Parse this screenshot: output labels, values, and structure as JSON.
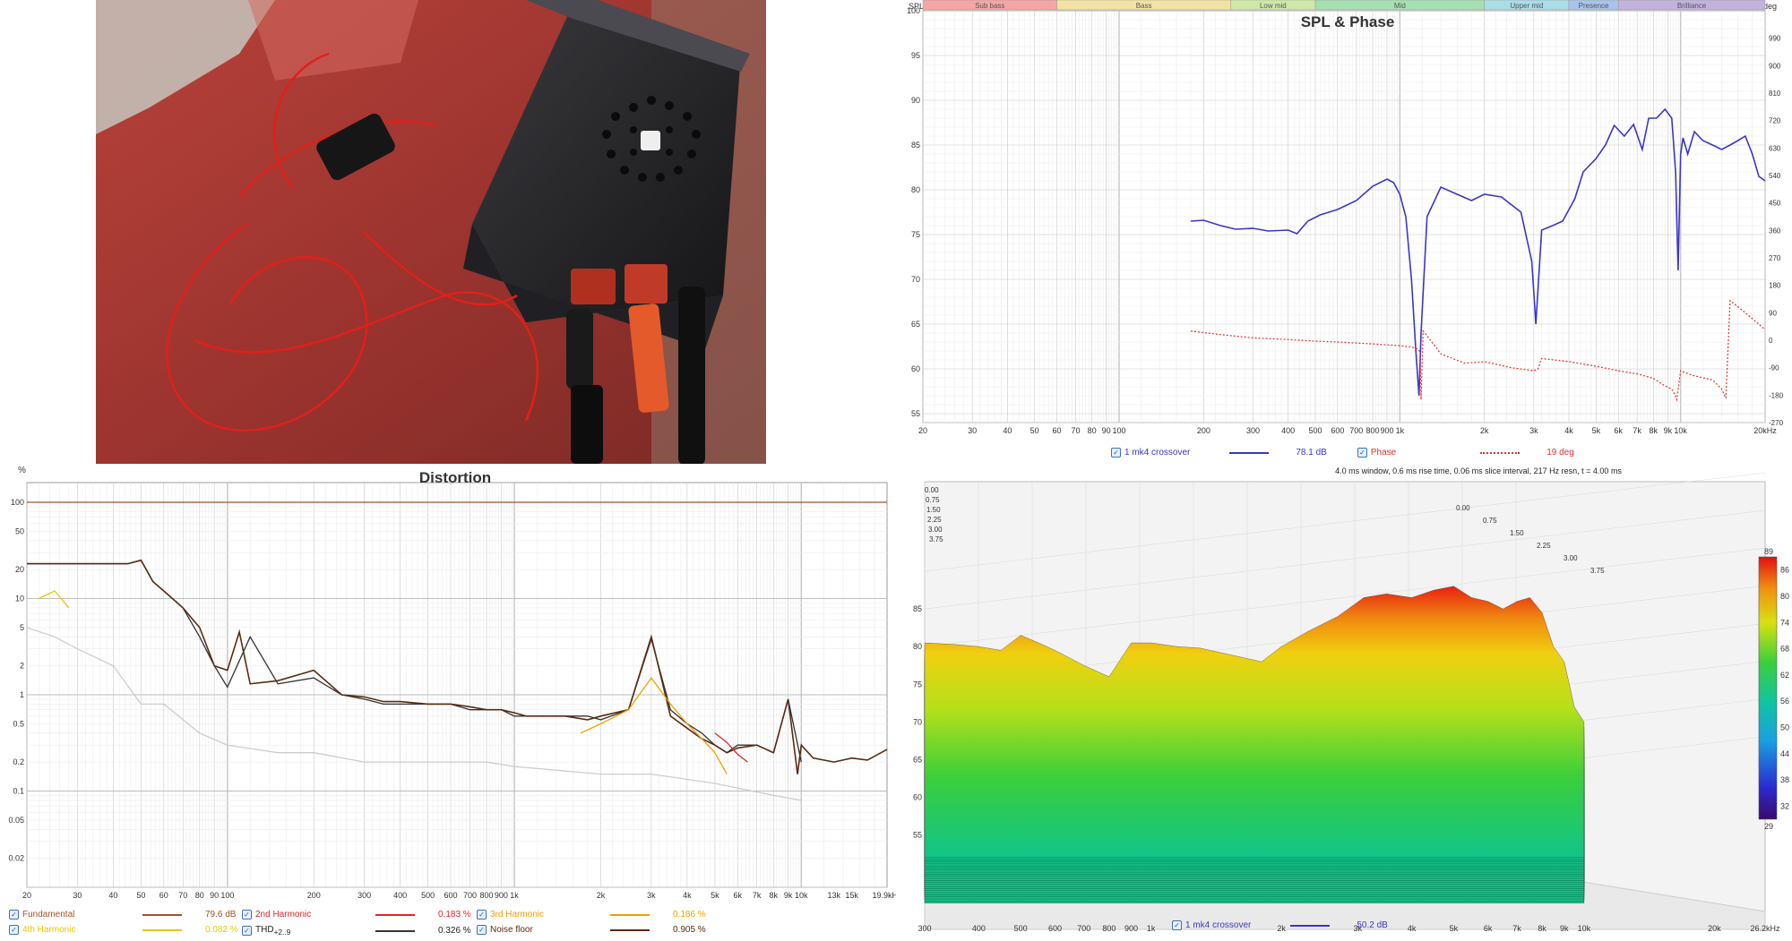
{
  "spl_phase": {
    "chart_data": {
      "type": "line",
      "title": "SPL & Phase",
      "ylabel_left": "SPL",
      "ylabel_right": "deg",
      "x_scale": "log",
      "xlim": [
        20,
        20000
      ],
      "ylim": [
        54,
        100
      ],
      "y2lim": [
        -270,
        1080
      ],
      "x_ticks": [
        "20",
        "30",
        "40",
        "50",
        "60",
        "70",
        "80",
        "90",
        "100",
        "200",
        "300",
        "400",
        "500",
        "600",
        "700",
        "800",
        "900",
        "1k",
        "2k",
        "3k",
        "4k",
        "5k",
        "6k",
        "7k",
        "8k",
        "9k",
        "10k",
        "20kHz"
      ],
      "y_ticks": [
        55,
        60,
        65,
        70,
        75,
        80,
        85,
        90,
        95,
        100
      ],
      "y2_ticks": [
        -270,
        -180,
        -90,
        0,
        90,
        180,
        270,
        360,
        450,
        540,
        630,
        720,
        810,
        900,
        990
      ],
      "bands": [
        {
          "name": "Sub bass",
          "from": 20,
          "to": 60,
          "color": "#f6a5a5"
        },
        {
          "name": "Bass",
          "from": 60,
          "to": 250,
          "color": "#f3e3a2"
        },
        {
          "name": "Low mid",
          "from": 250,
          "to": 500,
          "color": "#cfe8a8"
        },
        {
          "name": "Mid",
          "from": 500,
          "to": 2000,
          "color": "#a6e0b0"
        },
        {
          "name": "Upper mid",
          "from": 2000,
          "to": 4000,
          "color": "#a9dde8"
        },
        {
          "name": "Presence",
          "from": 4000,
          "to": 6000,
          "color": "#a8c4ec"
        },
        {
          "name": "Brilliance",
          "from": 6000,
          "to": 20000,
          "color": "#c2b2de"
        }
      ],
      "series": [
        {
          "name": "1 mk4 crossover",
          "value_label": "78.1 dB",
          "color": "#3b35c8",
          "x": [
            180,
            200,
            230,
            260,
            300,
            340,
            400,
            430,
            470,
            520,
            600,
            700,
            800,
            900,
            950,
            1000,
            1050,
            1100,
            1140,
            1170,
            1190,
            1250,
            1400,
            1600,
            1800,
            2000,
            2300,
            2700,
            2950,
            3050,
            3200,
            3500,
            3800,
            4200,
            4500,
            5000,
            5400,
            5800,
            6300,
            6800,
            7300,
            7700,
            8200,
            8800,
            9300,
            9600,
            9800,
            10000,
            10200,
            10600,
            11200,
            12000,
            13000,
            14000,
            15000,
            16000,
            17000,
            18000,
            19000,
            20000
          ],
          "y": [
            76.5,
            76.6,
            76,
            75.6,
            75.7,
            75.4,
            75.5,
            75.1,
            76.5,
            77.2,
            77.8,
            78.8,
            80.4,
            81.2,
            80.8,
            79.5,
            77,
            70,
            62,
            57,
            64,
            77,
            80.3,
            79.5,
            78.8,
            79.5,
            79.2,
            77.5,
            72,
            65,
            75.5,
            76,
            76.5,
            79,
            82,
            83.5,
            85,
            87.2,
            86,
            87.3,
            84.5,
            88,
            88,
            89,
            88,
            82,
            71,
            84,
            85.8,
            84,
            86.5,
            85.5,
            85,
            84.5,
            85,
            85.5,
            86,
            84,
            81.5,
            81
          ]
        },
        {
          "name": "Phase",
          "value_label": "19 deg",
          "color": "#e0302e",
          "style": "dotted",
          "x": [
            180,
            200,
            250,
            300,
            400,
            500,
            600,
            800,
            1000,
            1100,
            1150,
            1180,
            1190,
            1210,
            1260,
            1400,
            1700,
            2000,
            2500,
            3000,
            3100,
            3200,
            4000,
            5000,
            6000,
            7000,
            8000,
            8800,
            9300,
            9500,
            9700,
            10000,
            11000,
            13000,
            14000,
            14500,
            15000,
            17000,
            20000
          ],
          "y": [
            30,
            25,
            15,
            8,
            2,
            -3,
            -6,
            -12,
            -18,
            -22,
            -28,
            -38,
            -195,
            30,
            10,
            -45,
            -75,
            -70,
            -90,
            -100,
            -95,
            -60,
            -70,
            -85,
            -100,
            -110,
            -125,
            -150,
            -160,
            -175,
            -195,
            -100,
            -115,
            -130,
            -160,
            -190,
            130,
            90,
            35
          ]
        }
      ]
    }
  },
  "distortion": {
    "chart_data": {
      "type": "line",
      "title": "Distortion",
      "ylabel": "%",
      "x_scale": "log",
      "y_scale": "log",
      "xlim": [
        20,
        19900
      ],
      "ylim": [
        0.01,
        100
      ],
      "x_ticks": [
        "20",
        "30",
        "40",
        "50",
        "60",
        "70",
        "80",
        "90",
        "100",
        "1k",
        "200",
        "300",
        "400",
        "500",
        "600",
        "700",
        "800",
        "900",
        "2k",
        "3k",
        "4k",
        "5k",
        "6k",
        "7k",
        "8k",
        "9k",
        "10k",
        "13k",
        "15k",
        "19.9kHz"
      ],
      "y_ticks": [
        "100",
        "50",
        "20",
        "10",
        "5",
        "2",
        "1",
        "0.5",
        "0.2",
        "0.1",
        "0.05",
        "0.02"
      ],
      "series": [
        {
          "name": "Fundamental",
          "value_label": "79.6 dB",
          "color": "#a0522d",
          "x": [
            20,
            19900
          ],
          "y": [
            100,
            100
          ]
        },
        {
          "name": "2nd Harmonic",
          "value_label": "0.183 %",
          "color": "#e3242b",
          "x": [
            5000,
            5500,
            6000,
            6500
          ],
          "y": [
            0.4,
            0.32,
            0.24,
            0.2
          ]
        },
        {
          "name": "3rd Harmonic",
          "value_label": "0.186 %",
          "color": "#f0a000",
          "x": [
            1700,
            2000,
            2500,
            3000,
            3500,
            4000,
            4500,
            5000,
            5500
          ],
          "y": [
            0.4,
            0.5,
            0.7,
            1.5,
            0.8,
            0.5,
            0.35,
            0.25,
            0.15
          ]
        },
        {
          "name": "4th Harmonic",
          "value_label": "0.082 %",
          "color": "#e8c800",
          "x": [
            22,
            25,
            28
          ],
          "y": [
            10,
            12,
            8
          ]
        },
        {
          "name": "THD",
          "value_label": "0.326 %",
          "color": "#333333",
          "x": [
            20,
            25,
            30,
            35,
            40,
            45,
            50,
            55,
            60,
            70,
            80,
            90,
            100,
            120,
            150,
            200,
            250,
            300,
            350,
            400,
            500,
            600,
            700,
            800,
            900,
            1000,
            1200,
            1500,
            1800,
            2000,
            2500,
            3000,
            3500,
            4000,
            4500,
            5000,
            5500,
            6000,
            7000,
            8000,
            9000,
            10000
          ],
          "y": [
            23,
            23,
            23,
            23,
            23,
            23,
            25,
            15,
            12,
            8,
            4,
            2,
            1.2,
            4,
            1.3,
            1.5,
            1.0,
            0.9,
            0.8,
            0.8,
            0.8,
            0.8,
            0.7,
            0.7,
            0.7,
            0.6,
            0.6,
            0.6,
            0.6,
            0.55,
            0.7,
            3.8,
            0.7,
            0.5,
            0.4,
            0.3,
            0.25,
            0.3,
            0.3,
            0.25,
            0.9,
            0.2
          ]
        },
        {
          "name": "Noise floor",
          "value_label": "0.905 %",
          "color": "#5a2a14",
          "x": [
            20,
            25,
            30,
            35,
            40,
            45,
            50,
            55,
            60,
            70,
            80,
            90,
            100,
            110,
            120,
            150,
            200,
            250,
            300,
            350,
            400,
            500,
            600,
            700,
            800,
            900,
            1000,
            1100,
            1200,
            1500,
            1800,
            2000,
            2500,
            3000,
            3500,
            4000,
            4500,
            5000,
            5500,
            6000,
            7000,
            8000,
            9000,
            9700,
            10000,
            11000,
            13000,
            15000,
            17000,
            19900
          ],
          "y": [
            23,
            23,
            23,
            23,
            23,
            23,
            25,
            15,
            12,
            8,
            5,
            2,
            1.8,
            4.5,
            1.3,
            1.4,
            1.8,
            1.0,
            0.95,
            0.85,
            0.85,
            0.8,
            0.8,
            0.75,
            0.7,
            0.7,
            0.65,
            0.6,
            0.6,
            0.6,
            0.55,
            0.6,
            0.7,
            4.0,
            0.6,
            0.45,
            0.35,
            0.3,
            0.25,
            0.28,
            0.3,
            0.25,
            0.9,
            0.15,
            0.3,
            0.22,
            0.2,
            0.22,
            0.21,
            0.27
          ]
        },
        {
          "name": "grey-harmonics",
          "color": "#c8c8c8",
          "x": [
            20,
            25,
            30,
            40,
            50,
            60,
            80,
            100,
            150,
            200,
            300,
            500,
            800,
            1000,
            2000,
            3000,
            5000,
            8000,
            10000
          ],
          "y": [
            5,
            4,
            3,
            2,
            0.8,
            0.8,
            0.4,
            0.3,
            0.25,
            0.25,
            0.2,
            0.2,
            0.2,
            0.18,
            0.15,
            0.15,
            0.12,
            0.09,
            0.08
          ]
        }
      ]
    },
    "legend": [
      {
        "label": "Fundamental",
        "value": "79.6 dB",
        "color": "#a0522d"
      },
      {
        "label": "2nd Harmonic",
        "value": "0.183 %",
        "color": "#e3242b"
      },
      {
        "label": "3rd Harmonic",
        "value": "0.186 %",
        "color": "#f0a000"
      },
      {
        "label": "4th Harmonic",
        "value": "0.082 %",
        "color": "#e8c800"
      },
      {
        "label": "THD",
        "sub": "+2..9",
        "value": "0.326 %",
        "color": "#333333"
      },
      {
        "label": "Noise floor",
        "value": "0.905 %",
        "color": "#5a2a14"
      }
    ]
  },
  "waterfall": {
    "chart_data": {
      "type": "area",
      "info": "4.0 ms window, 0.6 ms rise time, 0.06 ms slice interval, 217 Hz resn, t = 4.00 ms",
      "x_scale": "log",
      "xlim": [
        300,
        26200
      ],
      "ylim": [
        52,
        90
      ],
      "x_ticks": [
        "300",
        "400",
        "500",
        "600",
        "700",
        "800",
        "900",
        "1k",
        "2k",
        "3k",
        "4k",
        "5k",
        "6k",
        "7k",
        "8k",
        "9k",
        "10k",
        "20k",
        "26.2kHz"
      ],
      "y_ticks": [
        55,
        60,
        65,
        70,
        75,
        80,
        85
      ],
      "time_ticks": [
        "0.00",
        "0.75",
        "1.50",
        "2.25",
        "3.00",
        "3.75"
      ],
      "colorbar": {
        "min": 29,
        "max": 89,
        "ticks": [
          32,
          38,
          44,
          50,
          56,
          62,
          68,
          74,
          80,
          86
        ],
        "top_label": "89",
        "bottom_label": "29"
      },
      "front_slice": {
        "x": [
          300,
          350,
          400,
          450,
          500,
          550,
          600,
          700,
          800,
          900,
          1000,
          1150,
          1300,
          1500,
          1800,
          2000,
          2300,
          2700,
          3100,
          3500,
          4000,
          4500,
          5000,
          5500,
          6000,
          6500,
          7000,
          7500,
          8000,
          8500,
          9000,
          9500,
          10000
        ],
        "y": [
          80.5,
          80.3,
          80,
          79.5,
          81.5,
          80.5,
          79.5,
          77.5,
          76,
          80.5,
          80.5,
          80,
          79.8,
          79,
          78,
          80,
          82,
          84,
          86.5,
          87,
          86.5,
          87.5,
          88,
          86.5,
          86,
          85,
          86,
          86.5,
          84.5,
          80,
          78,
          72,
          70
        ]
      }
    },
    "legend": {
      "label": "1 mk4 crossover",
      "value": "50.2 dB",
      "color": "#3b35c8"
    }
  }
}
